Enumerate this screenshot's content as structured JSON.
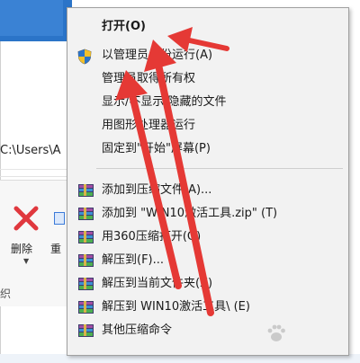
{
  "explorer": {
    "address_partial": "C:\\Users\\A",
    "ribbon": {
      "delete_label": "删除",
      "rename_label": "重",
      "organize_label": "织"
    }
  },
  "context_menu": {
    "items": [
      {
        "label": "打开(O)",
        "bold": true,
        "icon": ""
      },
      {
        "label": "以管理员身份运行(A)",
        "bold": false,
        "icon": "uac-shield-icon"
      },
      {
        "label": "管理员取得所有权",
        "bold": false,
        "icon": ""
      },
      {
        "label": "显示/不显示 隐藏的文件",
        "bold": false,
        "icon": ""
      },
      {
        "label": "用图形处理器运行",
        "bold": false,
        "icon": ""
      },
      {
        "label": "固定到\"开始\"屏幕(P)",
        "bold": false,
        "icon": ""
      },
      {
        "label": "添加到压缩文件(A)...",
        "bold": false,
        "icon": "winrar-icon"
      },
      {
        "label": "添加到 \"WIN10激活工具.zip\" (T)",
        "bold": false,
        "icon": "winrar-icon"
      },
      {
        "label": "用360压缩打开(Q)",
        "bold": false,
        "icon": "winrar-icon"
      },
      {
        "label": "解压到(F)...",
        "bold": false,
        "icon": "winrar-icon"
      },
      {
        "label": "解压到当前文件夹(X)",
        "bold": false,
        "icon": "winrar-icon"
      },
      {
        "label": "解压到 WIN10激活工具\\ (E)",
        "bold": false,
        "icon": "winrar-icon"
      },
      {
        "label": "其他压缩命令",
        "bold": false,
        "icon": "winrar-icon"
      }
    ]
  },
  "annotations": {
    "arrow_color": "#e53935",
    "arrow_count": 3
  },
  "colors": {
    "menu_bg": "#f2f2f2",
    "accent_blue": "#2b74c8",
    "delete_red": "#e0383e"
  }
}
